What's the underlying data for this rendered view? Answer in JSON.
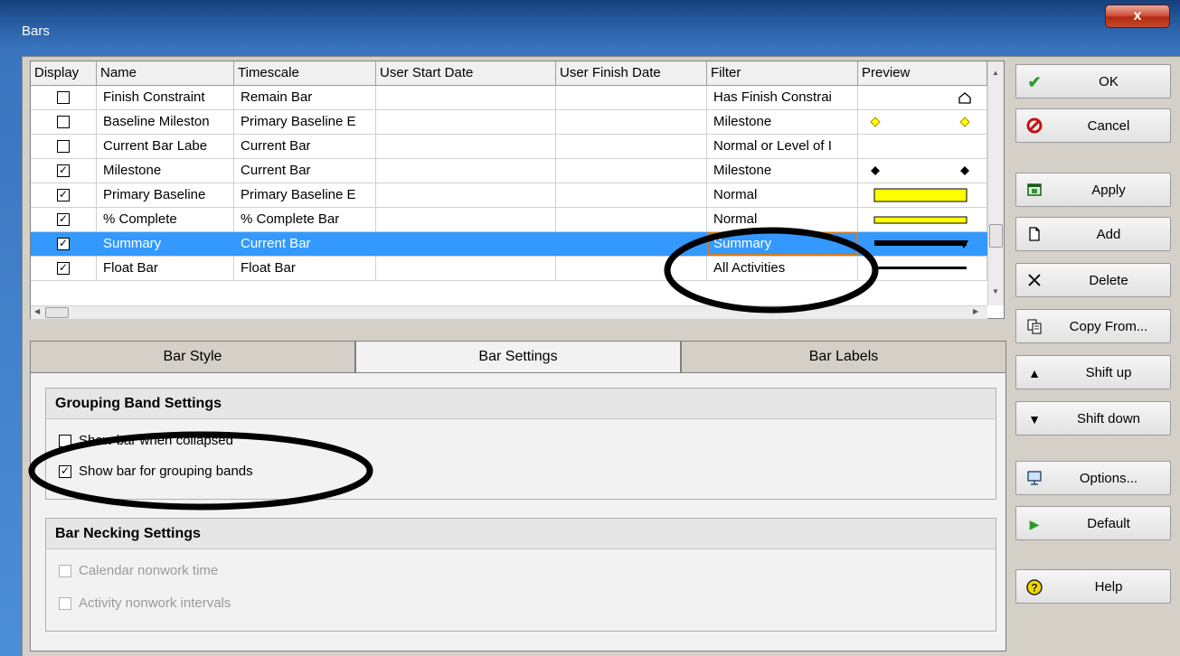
{
  "window": {
    "title": "Bars",
    "close_label": "x"
  },
  "grid": {
    "columns": [
      "Display",
      "Name",
      "Timescale",
      "User Start Date",
      "User Finish Date",
      "Filter",
      "Preview"
    ],
    "rows": [
      {
        "checked": false,
        "name": "Finish Constraint",
        "timescale": "Remain Bar",
        "user_start": "",
        "user_finish": "",
        "filter": "Has Finish Constrai",
        "preview": "finish-constraint-marker",
        "selected": false
      },
      {
        "checked": false,
        "name": "Baseline Mileston",
        "timescale": "Primary Baseline E",
        "user_start": "",
        "user_finish": "",
        "filter": "Milestone",
        "preview": "yellow-diamonds",
        "selected": false
      },
      {
        "checked": false,
        "name": "Current Bar Labe",
        "timescale": "Current Bar",
        "user_start": "",
        "user_finish": "",
        "filter": "Normal or Level of I",
        "preview": "none",
        "selected": false
      },
      {
        "checked": true,
        "name": "Milestone",
        "timescale": "Current Bar",
        "user_start": "",
        "user_finish": "",
        "filter": "Milestone",
        "preview": "black-diamonds",
        "selected": false
      },
      {
        "checked": true,
        "name": "Primary Baseline",
        "timescale": "Primary Baseline E",
        "user_start": "",
        "user_finish": "",
        "filter": "Normal",
        "preview": "yellow-thick-bar",
        "selected": false
      },
      {
        "checked": true,
        "name": "% Complete",
        "timescale": "% Complete Bar",
        "user_start": "",
        "user_finish": "",
        "filter": "Normal",
        "preview": "yellow-thin-bar",
        "selected": false
      },
      {
        "checked": true,
        "name": "Summary",
        "timescale": "Current Bar",
        "user_start": "",
        "user_finish": "",
        "filter": "Summary",
        "preview": "black-summary-bar",
        "selected": true
      },
      {
        "checked": true,
        "name": "Float Bar",
        "timescale": "Float Bar",
        "user_start": "",
        "user_finish": "",
        "filter": "All Activities",
        "preview": "black-line",
        "selected": false
      }
    ]
  },
  "tabs": [
    {
      "label": "Bar Style",
      "active": false
    },
    {
      "label": "Bar Settings",
      "active": true
    },
    {
      "label": "Bar Labels",
      "active": false
    }
  ],
  "grouping": {
    "heading": "Grouping Band Settings",
    "options": [
      {
        "label": "Show bar when collapsed",
        "checked": false,
        "enabled": true
      },
      {
        "label": "Show bar for grouping bands",
        "checked": true,
        "enabled": true
      }
    ]
  },
  "necking": {
    "heading": "Bar Necking Settings",
    "options": [
      {
        "label": "Calendar nonwork time",
        "checked": false,
        "enabled": false
      },
      {
        "label": "Activity nonwork intervals",
        "checked": false,
        "enabled": false
      }
    ]
  },
  "buttons": [
    {
      "label": "OK",
      "icon": "checkmark-icon"
    },
    {
      "label": "Cancel",
      "icon": "no-entry-icon"
    },
    {
      "label": "Apply",
      "icon": "apply-icon"
    },
    {
      "label": "Add",
      "icon": "new-document-icon"
    },
    {
      "label": "Delete",
      "icon": "x-delete-icon"
    },
    {
      "label": "Copy From...",
      "icon": "copy-icon"
    },
    {
      "label": "Shift up",
      "icon": "triangle-up-icon"
    },
    {
      "label": "Shift down",
      "icon": "triangle-down-icon"
    },
    {
      "label": "Options...",
      "icon": "options-icon"
    },
    {
      "label": "Default",
      "icon": "play-green-icon"
    },
    {
      "label": "Help",
      "icon": "help-icon"
    }
  ],
  "colors": {
    "title_bar": "#2a61a8",
    "selection": "#3399ff",
    "filter_highlight": "#d47b1c",
    "preview_yellow": "#ffff00",
    "ok_green": "#2e9a2e",
    "cancel_red": "#c0141a"
  }
}
